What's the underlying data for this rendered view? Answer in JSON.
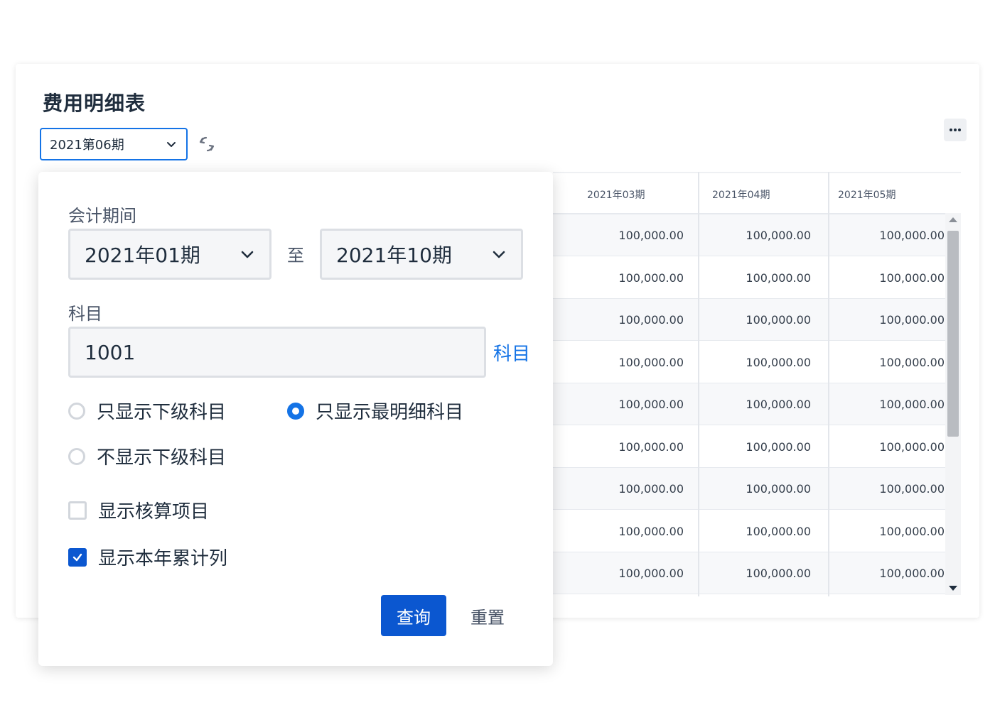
{
  "page": {
    "title": "费用明细表"
  },
  "toolbar": {
    "period_value": "2021第06期"
  },
  "grid": {
    "headers": [
      "2021年03期",
      "2021年04期",
      "2021年05期"
    ],
    "rows": [
      [
        "100,000.00",
        "100,000.00",
        "100,000.00"
      ],
      [
        "100,000.00",
        "100,000.00",
        "100,000.00"
      ],
      [
        "100,000.00",
        "100,000.00",
        "100,000.00"
      ],
      [
        "100,000.00",
        "100,000.00",
        "100,000.00"
      ],
      [
        "100,000.00",
        "100,000.00",
        "100,000.00"
      ],
      [
        "100,000.00",
        "100,000.00",
        "100,000.00"
      ],
      [
        "100,000.00",
        "100,000.00",
        "100,000.00"
      ],
      [
        "100,000.00",
        "100,000.00",
        "100,000.00"
      ],
      [
        "100,000.00",
        "100,000.00",
        "100,000.00"
      ]
    ]
  },
  "filter": {
    "period_label": "会计期间",
    "period_from": "2021年01期",
    "to_text": "至",
    "period_to": "2021年10期",
    "account_label": "科目",
    "account_value": "1001",
    "account_link": "科目",
    "options": {
      "subordinate_only": "只显示下级科目",
      "most_detailed": "只显示最明细科目",
      "no_subordinate": "不显示下级科目"
    },
    "selected_option": "most_detailed",
    "checks": {
      "show_accounting_items": "显示核算项目",
      "show_ytd_column": "显示本年累计列"
    },
    "checked": {
      "show_accounting_items": false,
      "show_ytd_column": true
    },
    "query_button": "查询",
    "reset_button": "重置"
  },
  "colors": {
    "accent": "#0b57d0",
    "link": "#1473e6",
    "text": "#1f2d3d"
  },
  "icons": {
    "period_chevron": "chevron-down-icon",
    "refresh": "refresh-icon",
    "more": "more-horizontal-icon",
    "check": "check-icon"
  }
}
